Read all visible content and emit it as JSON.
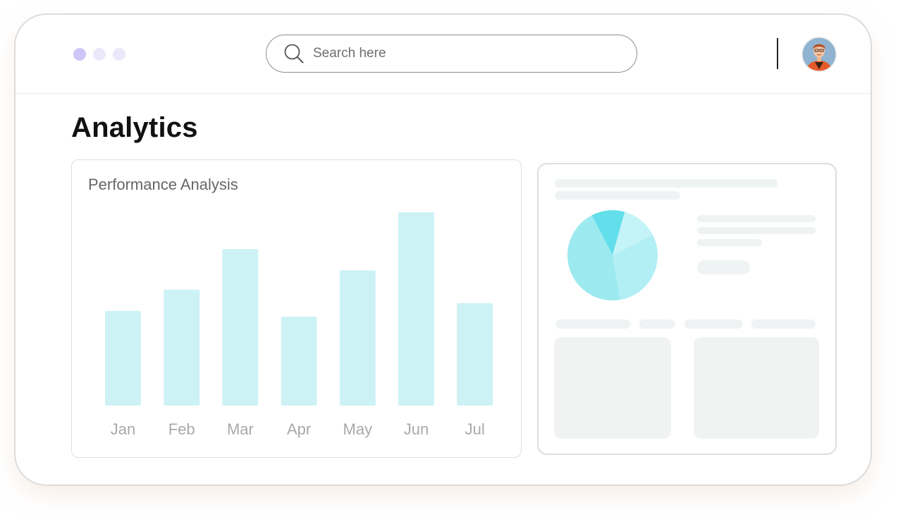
{
  "window": {
    "controls": [
      "window-dot-1",
      "window-dot-2",
      "window-dot-3"
    ],
    "colors": {
      "dot_active": "#cdc6f6",
      "dot_inactive": "#ebe8fb"
    }
  },
  "header": {
    "search": {
      "placeholder": "Search here",
      "value": ""
    },
    "avatar_icon": "person-avatar-icon"
  },
  "page": {
    "title": "Analytics"
  },
  "performance_card": {
    "title": "Performance Analysis"
  },
  "chart_data": {
    "type": "bar",
    "title": "Performance Analysis",
    "categories": [
      "Jan",
      "Feb",
      "Mar",
      "Apr",
      "May",
      "Jun",
      "Jul"
    ],
    "values": [
      49,
      60,
      81,
      46,
      70,
      100,
      53
    ],
    "ylim": [
      0,
      100
    ],
    "grid": false,
    "bar_color": "#cdf2f5",
    "label_color": "#a9a9a9"
  },
  "summary_card": {
    "pie": {
      "slices": [
        {
          "value": 12,
          "color": "#62dfea"
        },
        {
          "value": 13,
          "color": "#c5f4f8"
        },
        {
          "value": 30,
          "color": "#b2eff5"
        },
        {
          "value": 45,
          "color": "#9ceaf0"
        }
      ]
    }
  }
}
